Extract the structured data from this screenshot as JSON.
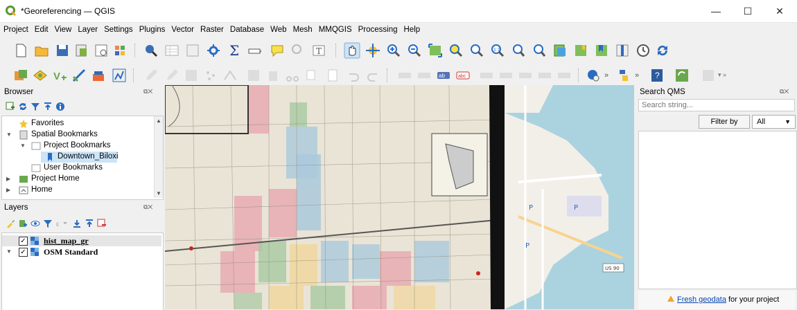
{
  "window": {
    "title": "*Georeferencing — QGIS",
    "minimize": "—",
    "maximize": "☐",
    "close": "✕"
  },
  "menu": [
    "Project",
    "Edit",
    "View",
    "Layer",
    "Settings",
    "Plugins",
    "Vector",
    "Raster",
    "Database",
    "Web",
    "Mesh",
    "MMQGIS",
    "Processing",
    "Help"
  ],
  "browser": {
    "title": "Browser",
    "items": [
      {
        "label": "Favorites"
      },
      {
        "label": "Spatial Bookmarks"
      },
      {
        "label": "Project Bookmarks"
      },
      {
        "label": "Downtown_Biloxi"
      },
      {
        "label": "User Bookmarks"
      },
      {
        "label": "Project Home"
      },
      {
        "label": "Home"
      }
    ]
  },
  "layers": {
    "title": "Layers",
    "items": [
      {
        "label": "hist_map_gr",
        "checked": "✓"
      },
      {
        "label": "OSM Standard",
        "checked": "✓"
      }
    ]
  },
  "qms": {
    "title": "Search QMS",
    "search_placeholder": "Search string...",
    "filter_button": "Filter by extent",
    "filter_select": "All",
    "footer_link": "Fresh geodata",
    "footer_text": " for your project"
  },
  "map_labels": {
    "us90": "US 90"
  },
  "colors": {
    "accent": "#2b7bd6",
    "qgis_green": "#589632"
  }
}
